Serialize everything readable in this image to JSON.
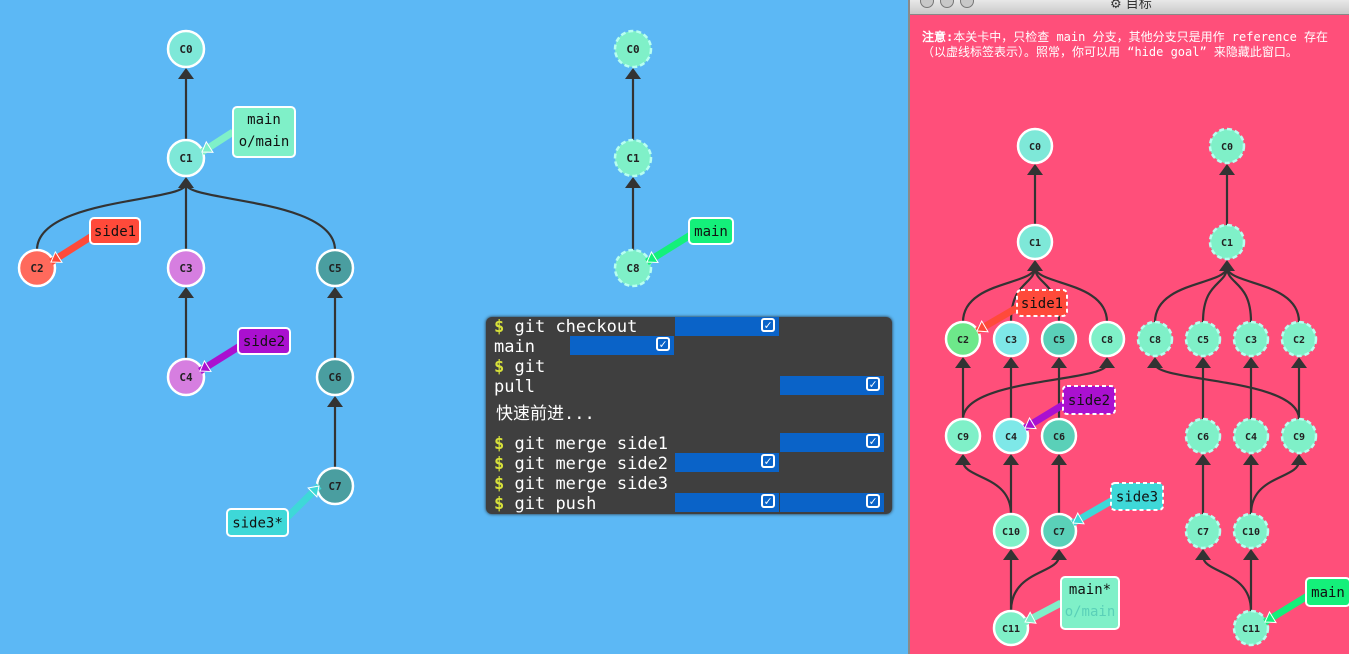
{
  "left_tree": {
    "commits": [
      {
        "id": "C0",
        "color": "#7ee8d8"
      },
      {
        "id": "C1",
        "color": "#7ee8d8"
      },
      {
        "id": "C2",
        "color": "#ff6a5c"
      },
      {
        "id": "C3",
        "color": "#d67ee0"
      },
      {
        "id": "C4",
        "color": "#d67ee0"
      },
      {
        "id": "C5",
        "color": "#4a9ea0"
      },
      {
        "id": "C6",
        "color": "#4a9ea0"
      },
      {
        "id": "C7",
        "color": "#4a9ea0"
      }
    ],
    "branches": [
      {
        "name": "main",
        "remote": "o/main",
        "color": "#7ff0c8"
      },
      {
        "name": "side1",
        "color": "#ff4a3a"
      },
      {
        "name": "side2",
        "color": "#aa10d0"
      },
      {
        "name": "side3*",
        "color": "#3ed8d8"
      }
    ]
  },
  "remote_tree": {
    "commits": [
      {
        "id": "C0",
        "color": "#7ff0c8"
      },
      {
        "id": "C1",
        "color": "#7ff0c8"
      },
      {
        "id": "C8",
        "color": "#7ff0c8"
      }
    ],
    "branches": [
      {
        "name": "main",
        "color": "#14f07a"
      }
    ]
  },
  "terminal": {
    "prompt": "$",
    "lines": [
      {
        "text": "git checkout"
      },
      {
        "text": "main"
      },
      {
        "text": "git"
      },
      {
        "text": "pull"
      },
      {
        "text": "快速前进..."
      },
      {
        "text": "git merge side1"
      },
      {
        "text": "git merge side2"
      },
      {
        "text": "git merge side3"
      },
      {
        "text": "git push"
      }
    ],
    "check_glyph": "✓"
  },
  "goal": {
    "title": "目标",
    "note_prefix": "注意:",
    "note": "本关卡中，只检查 main 分支，其他分支只是用作 reference 存在（以虚线标签表示）。照常，你可以用 “hide goal” 来隐藏此窗口。",
    "left": {
      "commits": [
        {
          "id": "C0",
          "color": "#7ee8d8"
        },
        {
          "id": "C1",
          "color": "#7ee8d8"
        },
        {
          "id": "C2",
          "color": "#6de88a"
        },
        {
          "id": "C3",
          "color": "#7ee8e8"
        },
        {
          "id": "C5",
          "color": "#5ad0b8"
        },
        {
          "id": "C8",
          "color": "#7ff0c8"
        },
        {
          "id": "C9",
          "color": "#7ff0c8"
        },
        {
          "id": "C4",
          "color": "#7ee8e8"
        },
        {
          "id": "C6",
          "color": "#5ad0b8"
        },
        {
          "id": "C10",
          "color": "#7ff0c8"
        },
        {
          "id": "C7",
          "color": "#5ad0b8"
        },
        {
          "id": "C11",
          "color": "#7ff0c8"
        }
      ],
      "branches": [
        {
          "name": "side1",
          "color": "#ff4a3a"
        },
        {
          "name": "side2",
          "color": "#aa10d0"
        },
        {
          "name": "side3",
          "color": "#3ed8d8"
        },
        {
          "name": "main*",
          "remote": "o/main",
          "color": "#7ff0c8"
        }
      ]
    },
    "right": {
      "commits": [
        {
          "id": "C0",
          "color": "#7ff0c8"
        },
        {
          "id": "C1",
          "color": "#7ff0c8"
        },
        {
          "id": "C8",
          "color": "#7ff0c8"
        },
        {
          "id": "C5",
          "color": "#7ff0c8"
        },
        {
          "id": "C3",
          "color": "#7ff0c8"
        },
        {
          "id": "C2",
          "color": "#7ff0c8"
        },
        {
          "id": "C6",
          "color": "#7ff0c8"
        },
        {
          "id": "C4",
          "color": "#7ff0c8"
        },
        {
          "id": "C9",
          "color": "#7ff0c8"
        },
        {
          "id": "C7",
          "color": "#7ff0c8"
        },
        {
          "id": "C10",
          "color": "#7ff0c8"
        },
        {
          "id": "C11",
          "color": "#7ff0c8"
        }
      ],
      "branches": [
        {
          "name": "main",
          "color": "#14f07a"
        }
      ]
    }
  }
}
